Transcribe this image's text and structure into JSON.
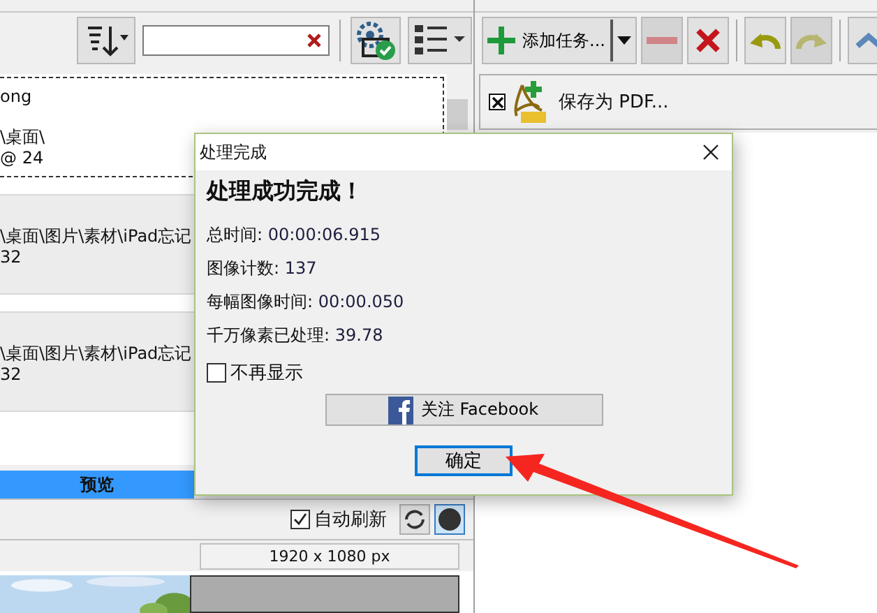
{
  "task_items": [
    {
      "lines": [
        "ong",
        "\\桌面\\",
        "@ 24"
      ],
      "selected": true
    },
    {
      "lines": [
        "\\桌面\\图片\\素材\\iPad忘记",
        "32"
      ],
      "selected": false
    },
    {
      "lines": [
        "\\桌面\\图片\\素材\\iPad忘记",
        "32"
      ],
      "selected": false
    }
  ],
  "preview_tab": {
    "label": "预览",
    "selected": true
  },
  "auto_refresh": {
    "label": "自动刷新",
    "checked": true
  },
  "image_size": "1920 x 1080 px",
  "right_toolbar": [
    {
      "kind": "add",
      "label": "添加任务...",
      "disabled": false
    },
    {
      "kind": "remove",
      "disabled": true
    },
    {
      "kind": "clear",
      "disabled": false
    },
    {
      "kind": "undo",
      "disabled": false
    },
    {
      "kind": "redo",
      "disabled": true
    },
    {
      "kind": "up",
      "disabled": false
    }
  ],
  "tasks": [
    {
      "label": "保存为 PDF...",
      "checked": true
    }
  ],
  "dialog": {
    "title": "处理完成",
    "heading": "处理成功完成！",
    "stats": [
      {
        "label": "总时间:",
        "value": "00:00:06.915"
      },
      {
        "label": "图像计数:",
        "value": "137"
      },
      {
        "label": "每幅图像时间:",
        "value": "00:00.050"
      },
      {
        "label": "千万像素已处理:",
        "value": "39.78"
      }
    ],
    "dont_show_again": {
      "label": "不再显示",
      "checked": false
    },
    "facebook_button": "关注 Facebook",
    "ok_button": "确定"
  }
}
